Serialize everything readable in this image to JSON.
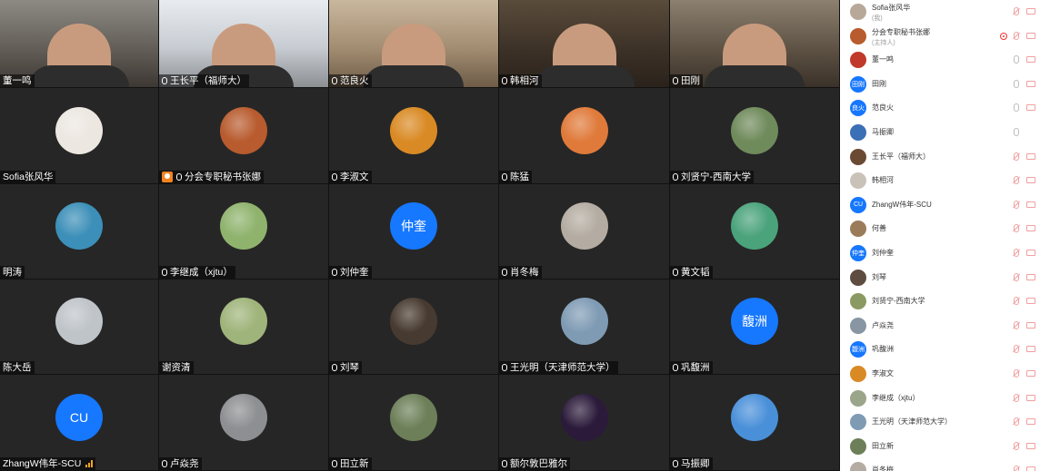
{
  "tiles": [
    {
      "name": "董一鸣",
      "mic": false,
      "type": "video",
      "v": "v1"
    },
    {
      "name": "王长平（福师大）",
      "mic": true,
      "type": "video",
      "v": "v2"
    },
    {
      "name": "范良火",
      "mic": true,
      "type": "video",
      "v": "v5"
    },
    {
      "name": "韩相河",
      "mic": true,
      "type": "video",
      "v": "v4"
    },
    {
      "name": "田刚",
      "mic": true,
      "type": "video",
      "v": "v3"
    },
    {
      "name": "Sofia张风华",
      "mic": false,
      "type": "avatar",
      "bg": "#ece7e1"
    },
    {
      "name": "分会专职秘书张娜",
      "mic": true,
      "host": true,
      "type": "avatar",
      "bg": "#b85b2e"
    },
    {
      "name": "李淑文",
      "mic": true,
      "type": "avatar",
      "bg": "#d98a24"
    },
    {
      "name": "陈猛",
      "mic": true,
      "type": "avatar",
      "bg": "#e07a3a"
    },
    {
      "name": "刘贤宁-西南大学",
      "mic": true,
      "type": "avatar",
      "bg": "#6f8a5b"
    },
    {
      "name": "明涛",
      "mic": false,
      "type": "avatar",
      "bg": "#3c8fb8"
    },
    {
      "name": "李继成（xjtu）",
      "mic": true,
      "type": "avatar",
      "bg": "#8fb36d"
    },
    {
      "name": "刘仲奎",
      "mic": true,
      "type": "text",
      "text": "仲奎"
    },
    {
      "name": "肖冬梅",
      "mic": true,
      "type": "avatar",
      "bg": "#b4aca2"
    },
    {
      "name": "黄文韬",
      "mic": true,
      "type": "avatar",
      "bg": "#4aa37b"
    },
    {
      "name": "陈大岳",
      "mic": false,
      "type": "avatar",
      "bg": "#bfc4c9"
    },
    {
      "name": "谢资清",
      "mic": false,
      "type": "avatar",
      "bg": "#9fb47a"
    },
    {
      "name": "刘琴",
      "mic": true,
      "type": "avatar",
      "bg": "#473a30"
    },
    {
      "name": "王光明（天津师范大学）",
      "mic": true,
      "type": "avatar",
      "bg": "#7f9bb4"
    },
    {
      "name": "巩馥洲",
      "mic": true,
      "type": "text",
      "text": "馥洲"
    },
    {
      "name": "ZhangW伟年-SCU",
      "mic": false,
      "signal": true,
      "type": "text",
      "text": "CU"
    },
    {
      "name": "卢焱尧",
      "mic": true,
      "type": "avatar",
      "bg": "#8d8f92"
    },
    {
      "name": "田立新",
      "mic": true,
      "type": "avatar",
      "bg": "#6c7f58"
    },
    {
      "name": "额尔敦巴雅尔",
      "mic": true,
      "type": "avatar",
      "bg": "#2b1a3a"
    },
    {
      "name": "马振卿",
      "mic": true,
      "type": "avatar",
      "bg": "#4a90d9"
    }
  ],
  "participants": [
    {
      "name": "Sofia张风华",
      "sub": "(我)",
      "av": "img",
      "avbg": "#b8a899",
      "mic": "off",
      "cam": "off"
    },
    {
      "name": "分会专职秘书张娜",
      "sub": "(主持人)",
      "av": "img",
      "avbg": "#b85b2e",
      "mic": "off",
      "cam": "off",
      "rec": true
    },
    {
      "name": "董一鸣",
      "av": "img",
      "avbg": "#c0392b",
      "mic": "on",
      "cam": "off"
    },
    {
      "name": "田刚",
      "av": "text",
      "avtext": "田刚",
      "mic": "on",
      "cam": "off"
    },
    {
      "name": "范良火",
      "av": "text",
      "avtext": "良火",
      "mic": "on",
      "cam": "off"
    },
    {
      "name": "马振卿",
      "av": "img",
      "avbg": "#3b6fb6",
      "mic": "on",
      "cam": "none"
    },
    {
      "name": "王长平（福师大）",
      "av": "img",
      "avbg": "#6b4a34",
      "mic": "off",
      "cam": "off"
    },
    {
      "name": "韩相河",
      "av": "img",
      "avbg": "#c9c2b8",
      "mic": "off",
      "cam": "off"
    },
    {
      "name": "ZhangW伟年-SCU",
      "av": "text",
      "avtext": "CU",
      "mic": "off",
      "cam": "off"
    },
    {
      "name": "何善",
      "av": "img",
      "avbg": "#9a7b5a",
      "mic": "off",
      "cam": "off"
    },
    {
      "name": "刘仲奎",
      "av": "text",
      "avtext": "仲奎",
      "mic": "off",
      "cam": "off"
    },
    {
      "name": "刘琴",
      "av": "img",
      "avbg": "#5d4c3f",
      "mic": "off",
      "cam": "off"
    },
    {
      "name": "刘贤宁-西南大学",
      "av": "img",
      "avbg": "#8a9a62",
      "mic": "off",
      "cam": "off"
    },
    {
      "name": "卢焱尧",
      "av": "img",
      "avbg": "#8895a3",
      "mic": "off",
      "cam": "off"
    },
    {
      "name": "巩馥洲",
      "av": "text",
      "avtext": "馥洲",
      "mic": "off",
      "cam": "off"
    },
    {
      "name": "李淑文",
      "av": "img",
      "avbg": "#d98a24",
      "mic": "off",
      "cam": "off"
    },
    {
      "name": "李继成（xjtu）",
      "av": "img",
      "avbg": "#9aa58a",
      "mic": "off",
      "cam": "off"
    },
    {
      "name": "王光明（天津师范大学）",
      "av": "img",
      "avbg": "#7f9bb4",
      "mic": "off",
      "cam": "off"
    },
    {
      "name": "田立新",
      "av": "img",
      "avbg": "#6c7f58",
      "mic": "off",
      "cam": "off"
    },
    {
      "name": "肖冬梅",
      "av": "img",
      "avbg": "#b4aca2",
      "mic": "off",
      "cam": "off"
    }
  ]
}
